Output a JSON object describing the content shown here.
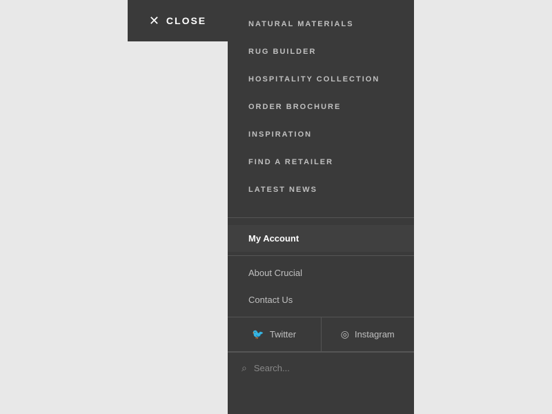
{
  "close": {
    "label": "CLOSE"
  },
  "nav_top": {
    "items": [
      {
        "label": "NATURAL MATERIALS"
      },
      {
        "label": "RUG BUILDER"
      },
      {
        "label": "HOSPITALITY COLLECTION"
      },
      {
        "label": "ORDER BROCHURE"
      },
      {
        "label": "INSPIRATION"
      },
      {
        "label": "FIND A RETAILER"
      },
      {
        "label": "LATEST NEWS"
      }
    ]
  },
  "nav_secondary": {
    "items": [
      {
        "label": "My Account",
        "type": "heading"
      },
      {
        "label": "About Crucial",
        "type": "link"
      },
      {
        "label": "Contact Us",
        "type": "link"
      }
    ]
  },
  "social": {
    "twitter": "Twitter",
    "instagram": "Instagram"
  },
  "search": {
    "placeholder": "Search..."
  }
}
